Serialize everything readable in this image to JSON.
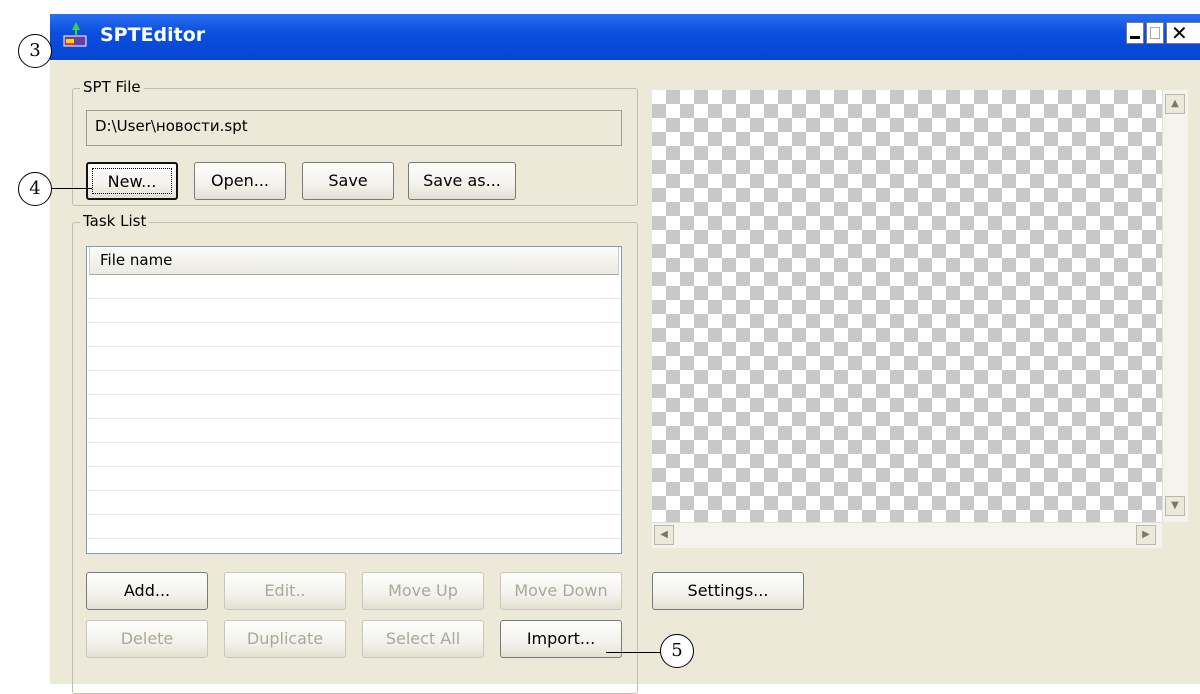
{
  "window": {
    "title": "SPTEditor",
    "controls": {
      "minimize": "minimize",
      "maximize": "maximize",
      "close": "close"
    }
  },
  "spt_file": {
    "group_label": "SPT File",
    "path_value": "D:\\User\\новости.spt",
    "buttons": {
      "new": "New...",
      "open": "Open...",
      "save": "Save",
      "save_as": "Save as..."
    }
  },
  "task_list": {
    "group_label": "Task List",
    "column_header": "File name",
    "rows": [],
    "buttons": {
      "add": "Add...",
      "edit": "Edit..",
      "move_up": "Move Up",
      "move_down": "Move Down",
      "delete": "Delete",
      "duplicate": "Duplicate",
      "select_all": "Select All",
      "import": "Import..."
    }
  },
  "preview": {
    "settings_label": "Settings..."
  },
  "callouts": {
    "c3": "3",
    "c4": "4",
    "c5": "5"
  },
  "colors": {
    "titlebar": "#0a4fe0",
    "window_bg": "#ece9d8",
    "disabled_text": "#aaa89c"
  },
  "icons": {
    "app": "spt-editor-icon",
    "minimize": "minimize-icon",
    "maximize": "maximize-icon",
    "close": "close-icon"
  }
}
